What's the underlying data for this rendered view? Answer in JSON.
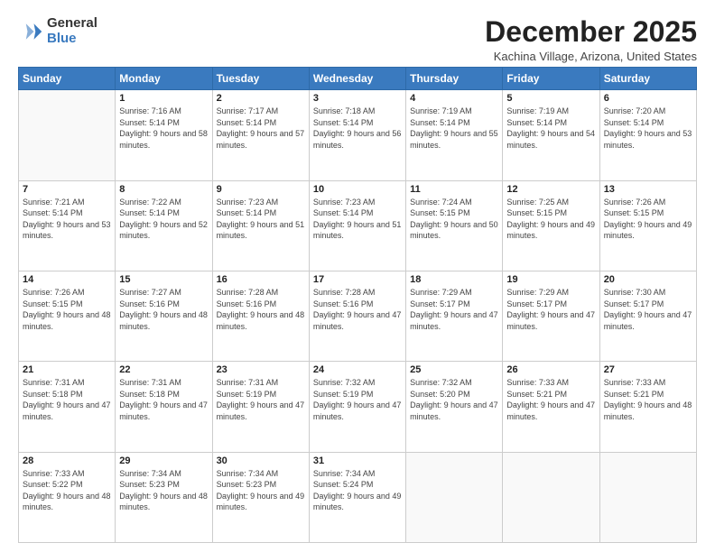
{
  "logo": {
    "general": "General",
    "blue": "Blue"
  },
  "title": "December 2025",
  "location": "Kachina Village, Arizona, United States",
  "days_of_week": [
    "Sunday",
    "Monday",
    "Tuesday",
    "Wednesday",
    "Thursday",
    "Friday",
    "Saturday"
  ],
  "weeks": [
    [
      {
        "day": null,
        "sunrise": null,
        "sunset": null,
        "daylight": null
      },
      {
        "day": "1",
        "sunrise": "Sunrise: 7:16 AM",
        "sunset": "Sunset: 5:14 PM",
        "daylight": "Daylight: 9 hours and 58 minutes."
      },
      {
        "day": "2",
        "sunrise": "Sunrise: 7:17 AM",
        "sunset": "Sunset: 5:14 PM",
        "daylight": "Daylight: 9 hours and 57 minutes."
      },
      {
        "day": "3",
        "sunrise": "Sunrise: 7:18 AM",
        "sunset": "Sunset: 5:14 PM",
        "daylight": "Daylight: 9 hours and 56 minutes."
      },
      {
        "day": "4",
        "sunrise": "Sunrise: 7:19 AM",
        "sunset": "Sunset: 5:14 PM",
        "daylight": "Daylight: 9 hours and 55 minutes."
      },
      {
        "day": "5",
        "sunrise": "Sunrise: 7:19 AM",
        "sunset": "Sunset: 5:14 PM",
        "daylight": "Daylight: 9 hours and 54 minutes."
      },
      {
        "day": "6",
        "sunrise": "Sunrise: 7:20 AM",
        "sunset": "Sunset: 5:14 PM",
        "daylight": "Daylight: 9 hours and 53 minutes."
      }
    ],
    [
      {
        "day": "7",
        "sunrise": "Sunrise: 7:21 AM",
        "sunset": "Sunset: 5:14 PM",
        "daylight": "Daylight: 9 hours and 53 minutes."
      },
      {
        "day": "8",
        "sunrise": "Sunrise: 7:22 AM",
        "sunset": "Sunset: 5:14 PM",
        "daylight": "Daylight: 9 hours and 52 minutes."
      },
      {
        "day": "9",
        "sunrise": "Sunrise: 7:23 AM",
        "sunset": "Sunset: 5:14 PM",
        "daylight": "Daylight: 9 hours and 51 minutes."
      },
      {
        "day": "10",
        "sunrise": "Sunrise: 7:23 AM",
        "sunset": "Sunset: 5:14 PM",
        "daylight": "Daylight: 9 hours and 51 minutes."
      },
      {
        "day": "11",
        "sunrise": "Sunrise: 7:24 AM",
        "sunset": "Sunset: 5:15 PM",
        "daylight": "Daylight: 9 hours and 50 minutes."
      },
      {
        "day": "12",
        "sunrise": "Sunrise: 7:25 AM",
        "sunset": "Sunset: 5:15 PM",
        "daylight": "Daylight: 9 hours and 49 minutes."
      },
      {
        "day": "13",
        "sunrise": "Sunrise: 7:26 AM",
        "sunset": "Sunset: 5:15 PM",
        "daylight": "Daylight: 9 hours and 49 minutes."
      }
    ],
    [
      {
        "day": "14",
        "sunrise": "Sunrise: 7:26 AM",
        "sunset": "Sunset: 5:15 PM",
        "daylight": "Daylight: 9 hours and 48 minutes."
      },
      {
        "day": "15",
        "sunrise": "Sunrise: 7:27 AM",
        "sunset": "Sunset: 5:16 PM",
        "daylight": "Daylight: 9 hours and 48 minutes."
      },
      {
        "day": "16",
        "sunrise": "Sunrise: 7:28 AM",
        "sunset": "Sunset: 5:16 PM",
        "daylight": "Daylight: 9 hours and 48 minutes."
      },
      {
        "day": "17",
        "sunrise": "Sunrise: 7:28 AM",
        "sunset": "Sunset: 5:16 PM",
        "daylight": "Daylight: 9 hours and 47 minutes."
      },
      {
        "day": "18",
        "sunrise": "Sunrise: 7:29 AM",
        "sunset": "Sunset: 5:17 PM",
        "daylight": "Daylight: 9 hours and 47 minutes."
      },
      {
        "day": "19",
        "sunrise": "Sunrise: 7:29 AM",
        "sunset": "Sunset: 5:17 PM",
        "daylight": "Daylight: 9 hours and 47 minutes."
      },
      {
        "day": "20",
        "sunrise": "Sunrise: 7:30 AM",
        "sunset": "Sunset: 5:17 PM",
        "daylight": "Daylight: 9 hours and 47 minutes."
      }
    ],
    [
      {
        "day": "21",
        "sunrise": "Sunrise: 7:31 AM",
        "sunset": "Sunset: 5:18 PM",
        "daylight": "Daylight: 9 hours and 47 minutes."
      },
      {
        "day": "22",
        "sunrise": "Sunrise: 7:31 AM",
        "sunset": "Sunset: 5:18 PM",
        "daylight": "Daylight: 9 hours and 47 minutes."
      },
      {
        "day": "23",
        "sunrise": "Sunrise: 7:31 AM",
        "sunset": "Sunset: 5:19 PM",
        "daylight": "Daylight: 9 hours and 47 minutes."
      },
      {
        "day": "24",
        "sunrise": "Sunrise: 7:32 AM",
        "sunset": "Sunset: 5:19 PM",
        "daylight": "Daylight: 9 hours and 47 minutes."
      },
      {
        "day": "25",
        "sunrise": "Sunrise: 7:32 AM",
        "sunset": "Sunset: 5:20 PM",
        "daylight": "Daylight: 9 hours and 47 minutes."
      },
      {
        "day": "26",
        "sunrise": "Sunrise: 7:33 AM",
        "sunset": "Sunset: 5:21 PM",
        "daylight": "Daylight: 9 hours and 47 minutes."
      },
      {
        "day": "27",
        "sunrise": "Sunrise: 7:33 AM",
        "sunset": "Sunset: 5:21 PM",
        "daylight": "Daylight: 9 hours and 48 minutes."
      }
    ],
    [
      {
        "day": "28",
        "sunrise": "Sunrise: 7:33 AM",
        "sunset": "Sunset: 5:22 PM",
        "daylight": "Daylight: 9 hours and 48 minutes."
      },
      {
        "day": "29",
        "sunrise": "Sunrise: 7:34 AM",
        "sunset": "Sunset: 5:23 PM",
        "daylight": "Daylight: 9 hours and 48 minutes."
      },
      {
        "day": "30",
        "sunrise": "Sunrise: 7:34 AM",
        "sunset": "Sunset: 5:23 PM",
        "daylight": "Daylight: 9 hours and 49 minutes."
      },
      {
        "day": "31",
        "sunrise": "Sunrise: 7:34 AM",
        "sunset": "Sunset: 5:24 PM",
        "daylight": "Daylight: 9 hours and 49 minutes."
      },
      {
        "day": null,
        "sunrise": null,
        "sunset": null,
        "daylight": null
      },
      {
        "day": null,
        "sunrise": null,
        "sunset": null,
        "daylight": null
      },
      {
        "day": null,
        "sunrise": null,
        "sunset": null,
        "daylight": null
      }
    ]
  ]
}
